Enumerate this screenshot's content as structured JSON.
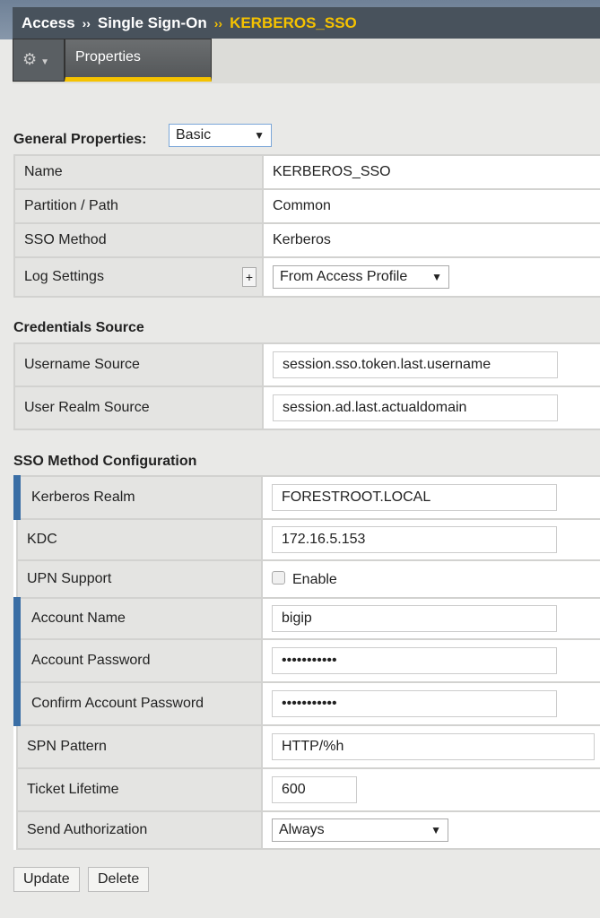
{
  "breadcrumb": {
    "items": [
      "Access",
      "Single Sign-On"
    ],
    "separator": "››",
    "current": "KERBEROS_SSO"
  },
  "tabs": {
    "gear_icon": "gear-icon",
    "active": "Properties"
  },
  "general": {
    "label": "General Properties:",
    "mode": "Basic",
    "rows": [
      {
        "label": "Name",
        "value": "KERBEROS_SSO"
      },
      {
        "label": "Partition / Path",
        "value": "Common"
      },
      {
        "label": "SSO Method",
        "value": "Kerberos"
      },
      {
        "label": "Log Settings",
        "value": "From Access Profile"
      }
    ]
  },
  "credentials": {
    "title": "Credentials Source",
    "rows": [
      {
        "label": "Username Source",
        "value": "session.sso.token.last.username"
      },
      {
        "label": "User Realm Source",
        "value": "session.ad.last.actualdomain"
      }
    ]
  },
  "sso": {
    "title": "SSO Method Configuration",
    "rows": [
      {
        "label": "Kerberos Realm",
        "value": "FORESTROOT.LOCAL"
      },
      {
        "label": "KDC",
        "value": "172.16.5.153"
      },
      {
        "label": "UPN Support",
        "value": "Enable",
        "checked": false
      },
      {
        "label": "Account Name",
        "value": "bigip"
      },
      {
        "label": "Account Password",
        "value": "•••••••••••"
      },
      {
        "label": "Confirm Account Password",
        "value": "•••••••••••"
      },
      {
        "label": "SPN Pattern",
        "value": "HTTP/%h"
      },
      {
        "label": "Ticket Lifetime",
        "value": "600"
      },
      {
        "label": "Send Authorization",
        "value": "Always"
      }
    ]
  },
  "buttons": {
    "update": "Update",
    "delete": "Delete"
  },
  "colors": {
    "accent": "#f5c200",
    "required": "#3a6ea5"
  }
}
